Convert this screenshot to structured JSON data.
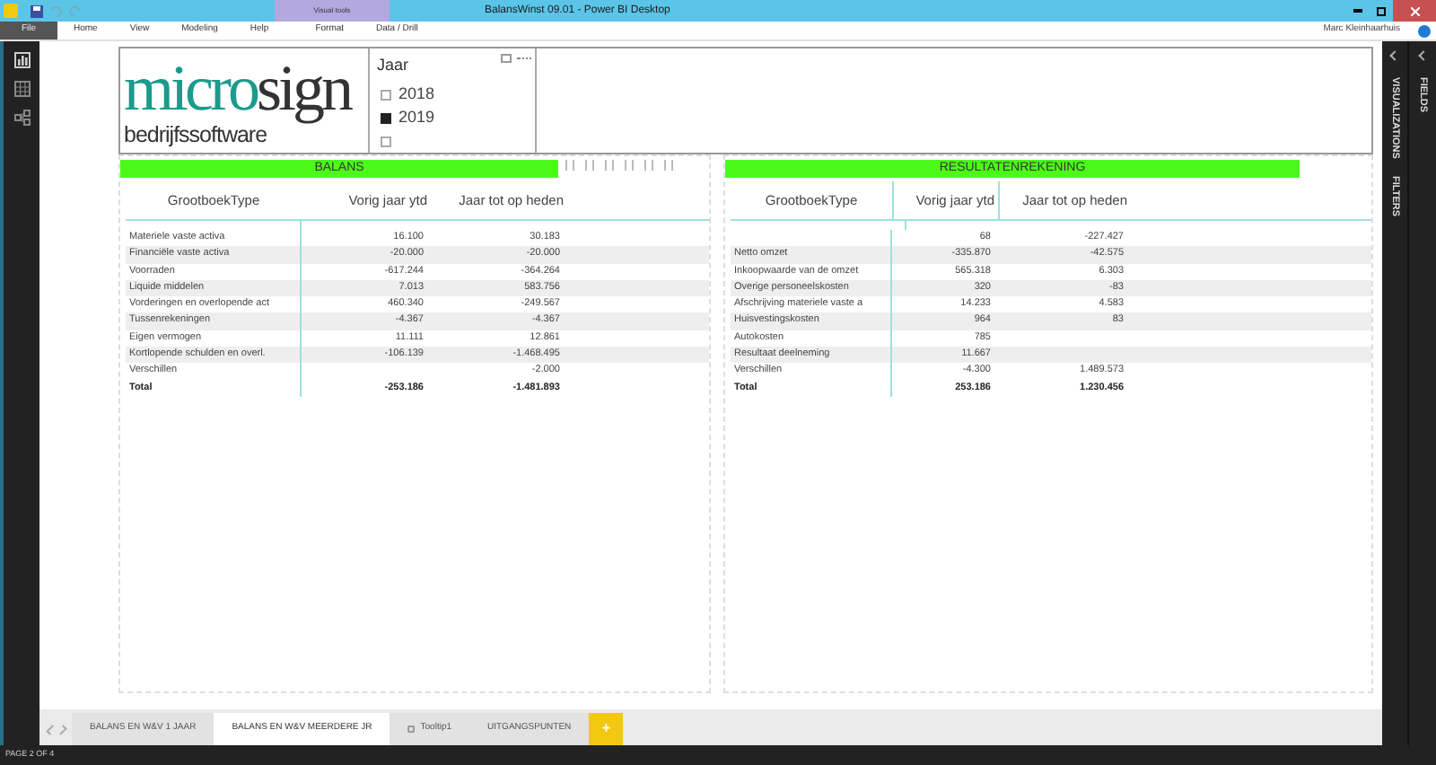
{
  "window": {
    "title": "BalansWinst 09.01 - Power BI Desktop",
    "context_tab": "Visual tools"
  },
  "ribbon": {
    "tabs": [
      {
        "label": "File",
        "kind": "file",
        "selected": false
      },
      {
        "label": "Home",
        "kind": "tab",
        "selected": false
      },
      {
        "label": "View",
        "kind": "tab",
        "selected": false
      },
      {
        "label": "Modeling",
        "kind": "tab",
        "selected": false
      },
      {
        "label": "Help",
        "kind": "tab",
        "selected": false
      },
      {
        "label": "Format",
        "kind": "tab",
        "selected": false
      },
      {
        "label": "Data / Drill",
        "kind": "tab",
        "selected": false
      }
    ],
    "user": "Marc Kleinhaarhuis"
  },
  "logo": {
    "part_1": "micro",
    "part_2": "sign",
    "subtitle": "bedrijfssoftware"
  },
  "slicer": {
    "title": "Jaar",
    "items": [
      {
        "label": "2018",
        "checked": false
      },
      {
        "label": "2019",
        "checked": true
      },
      {
        "checked": false
      }
    ]
  },
  "tables": [
    {
      "title": "BALANS",
      "columns": [
        "GrootboekType",
        "Vorig jaar ytd",
        "Jaar tot op heden"
      ],
      "rows": [
        [
          "Materiele vaste activa",
          "16.100",
          "30.183"
        ],
        [
          "Financiële vaste activa",
          "-20.000",
          "-20.000"
        ],
        [
          "Voorraden",
          "-617.244",
          "-364.264"
        ],
        [
          "Liquide middelen",
          "7.013",
          "583.756"
        ],
        [
          "Vorderingen en overlopende act",
          "460.340",
          "-249.567"
        ],
        [
          "Tussenrekeningen",
          "-4.367",
          "-4.367"
        ],
        [
          "Eigen vermogen",
          "11.111",
          "12.861"
        ],
        [
          "Kortlopende schulden en overl.",
          "-106.139",
          "-1.468.495"
        ],
        [
          "Verschillen",
          "",
          "-2.000"
        ]
      ],
      "total": [
        "Total",
        "-253.186",
        "-1.481.893"
      ],
      "toolbar": true
    },
    {
      "title": "RESULTATENREKENING",
      "columns": [
        "GrootboekType",
        "Vorig jaar ytd",
        "Jaar tot op heden"
      ],
      "rows": [
        [
          "",
          "68",
          "-227.427"
        ],
        [
          "Netto omzet",
          "-335.870",
          "-42.575"
        ],
        [
          "Inkoopwaarde van de omzet",
          "565.318",
          "6.303"
        ],
        [
          "Overige personeelskosten",
          "320",
          "-83"
        ],
        [
          "Afschrijving materiele vaste a",
          "14.233",
          "4.583"
        ],
        [
          "Huisvestingskosten",
          "964",
          "83"
        ],
        [
          "Autokosten",
          "785",
          ""
        ],
        [
          "Resultaat deelneming",
          "11.667",
          ""
        ],
        [
          "Verschillen",
          "-4.300",
          "1.489.573"
        ]
      ],
      "total": [
        "Total",
        "253.186",
        "1.230.456"
      ],
      "toolbar": false
    }
  ],
  "panes": [
    {
      "label": "VISUALIZATIONS"
    },
    {
      "label": "FILTERS"
    },
    {
      "label": "FIELDS"
    }
  ],
  "page_tabs": [
    {
      "label": "BALANS EN W&V 1 JAAR",
      "kind": "page",
      "selected": false
    },
    {
      "label": "BALANS EN W&V MEERDERE JR",
      "kind": "page",
      "selected": true
    },
    {
      "label": "Tooltip1",
      "kind": "tooltip",
      "selected": false
    },
    {
      "label": "UITGANGSPUNTEN",
      "kind": "page",
      "selected": false
    },
    {
      "label": "+",
      "kind": "add",
      "selected": false
    }
  ],
  "status_bar": "PAGE 2 OF 4"
}
